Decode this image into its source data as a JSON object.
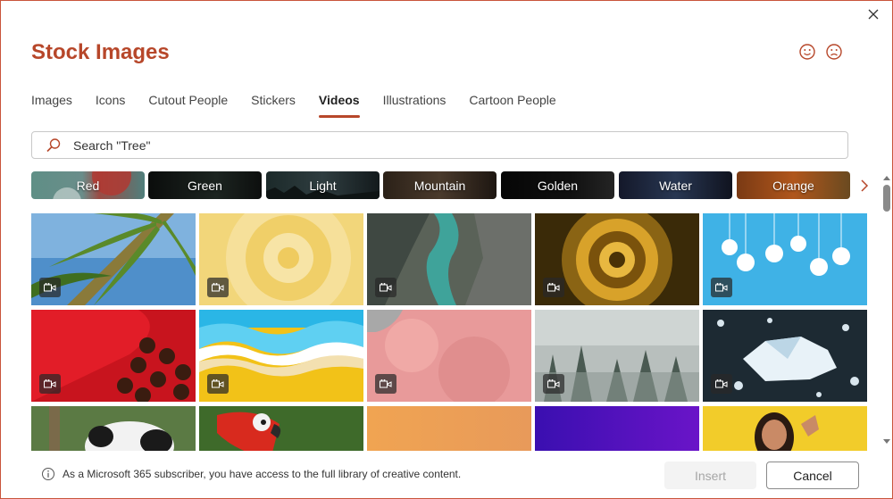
{
  "dialog": {
    "title": "Stock Images",
    "close_icon": "close-icon",
    "feedback_smile_icon": "smile-icon",
    "feedback_frown_icon": "frown-icon"
  },
  "tabs": [
    {
      "label": "Images",
      "active": false
    },
    {
      "label": "Icons",
      "active": false
    },
    {
      "label": "Cutout People",
      "active": false
    },
    {
      "label": "Stickers",
      "active": false
    },
    {
      "label": "Videos",
      "active": true
    },
    {
      "label": "Illustrations",
      "active": false
    },
    {
      "label": "Cartoon People",
      "active": false
    }
  ],
  "search": {
    "placeholder": "Search \"Tree\"",
    "value": "",
    "icon": "search-icon"
  },
  "chips": [
    {
      "label": "Red"
    },
    {
      "label": "Green"
    },
    {
      "label": "Light"
    },
    {
      "label": "Mountain"
    },
    {
      "label": "Golden"
    },
    {
      "label": "Water"
    },
    {
      "label": "Orange"
    }
  ],
  "results": [
    {
      "subject": "palm leaves against sky",
      "type": "video"
    },
    {
      "subject": "yellow swirl pattern",
      "type": "video"
    },
    {
      "subject": "river through rocky canyon",
      "type": "video"
    },
    {
      "subject": "golden spiral",
      "type": "video"
    },
    {
      "subject": "snowflake ornaments on blue",
      "type": "video"
    },
    {
      "subject": "heart box of chocolates",
      "type": "video"
    },
    {
      "subject": "paper waves blue and yellow",
      "type": "video"
    },
    {
      "subject": "pink ice cream scoop",
      "type": "video"
    },
    {
      "subject": "misty forest",
      "type": "video"
    },
    {
      "subject": "iceberg in dark water",
      "type": "video"
    },
    {
      "subject": "panda",
      "type": "video"
    },
    {
      "subject": "red macaw parrot",
      "type": "video"
    },
    {
      "subject": "orange gradient",
      "type": "video"
    },
    {
      "subject": "purple gradient",
      "type": "video"
    },
    {
      "subject": "woman waving on yellow",
      "type": "video"
    }
  ],
  "footer": {
    "info_text": "As a Microsoft 365 subscriber, you have access to the full library of creative content.",
    "insert_label": "Insert",
    "insert_enabled": false,
    "cancel_label": "Cancel"
  },
  "colors": {
    "accent": "#b7472a",
    "border": "#c9543b"
  }
}
